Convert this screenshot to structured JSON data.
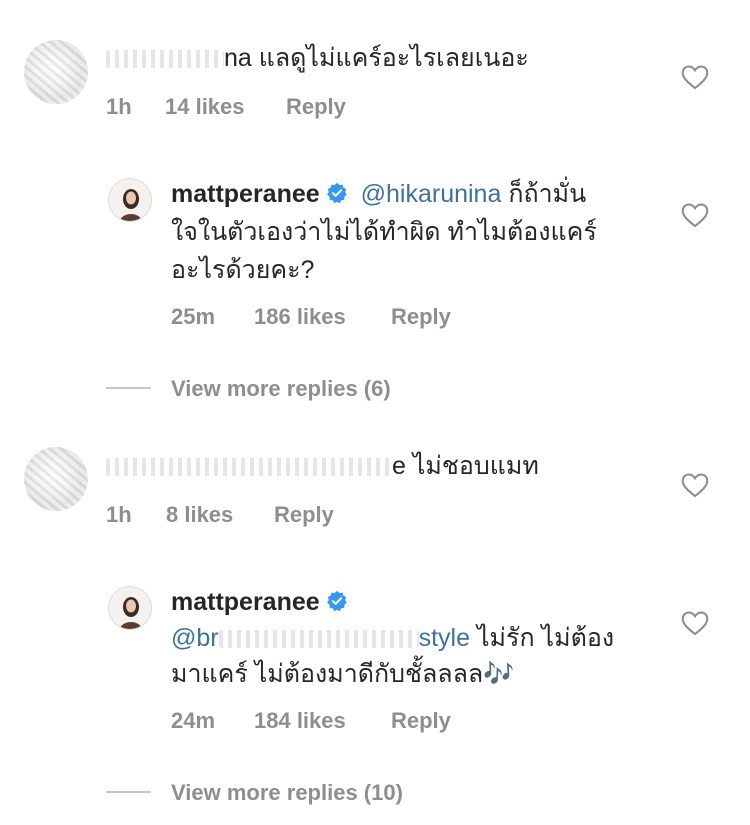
{
  "comments": [
    {
      "text_tail": "na แลดูไม่แคร์อะไรเลยเนอะ",
      "time": "1h",
      "likes": "14 likes",
      "reply": "Reply"
    },
    {
      "username": "mattperanee",
      "mention": "@hikarunina",
      "text_line1": "ก็ถ้ามั่น",
      "text_line2": "ใจในตัวเองว่าไม่ได้ทำผิด ทำไมต้องแคร์",
      "text_line3": "อะไรด้วยคะ?",
      "time": "25m",
      "likes": "186 likes",
      "reply": "Reply"
    },
    {
      "view_more": "View more replies (6)"
    },
    {
      "text_tail": "e ไม่ชอบแมท",
      "time": "1h",
      "likes": "8 likes",
      "reply": "Reply"
    },
    {
      "username": "mattperanee",
      "mention": "@br",
      "mention_tail": "style",
      "text_line1": "ไม่รัก ไม่ต้อง",
      "text_line2": "มาแคร์ ไม่ต้องมาดีกับชั้ลลลล🎶",
      "time": "24m",
      "likes": "184 likes",
      "reply": "Reply"
    },
    {
      "view_more": "View more replies (10)"
    }
  ],
  "icons": {
    "heart": "heart-outline-icon",
    "verified": "verified-badge-icon",
    "verified_color": "#3897f0"
  }
}
